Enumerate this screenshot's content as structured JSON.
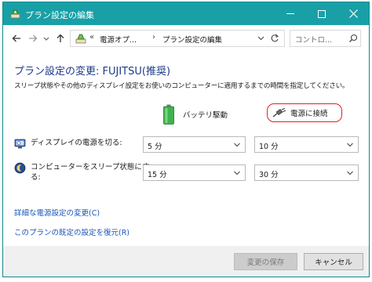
{
  "window": {
    "title": "プラン設定の編集",
    "accent": "#18a0a6"
  },
  "nav": {
    "breadcrumb_sep1": "«",
    "breadcrumb_1": "電源オプ...",
    "breadcrumb_sep2": "›",
    "breadcrumb_2": "プラン設定の編集",
    "search_placeholder": "コントロ..."
  },
  "content": {
    "heading": "プラン設定の変更: FUJITSU(推奨)",
    "description": "スリープ状態やその他のディスプレイ設定をお使いのコンピューターに適用するまでの時間を指定してください。",
    "columns": {
      "battery": "バッテリ駆動",
      "plugged_in": "電源に接続"
    },
    "rows": [
      {
        "label": "ディスプレイの電源を切る:",
        "icon": "display-off-icon",
        "battery_value": "5 分",
        "plugged_value": "10 分"
      },
      {
        "label_line1": "コンピューターをスリープ状態にす",
        "label_line2": "る:",
        "icon": "sleep-icon",
        "battery_value": "15 分",
        "plugged_value": "30 分"
      }
    ],
    "links": {
      "advanced": "詳細な電源設定の変更(C)",
      "restore": "このプランの既定の設定を復元(R)"
    }
  },
  "footer": {
    "save_label": "変更の保存",
    "cancel_label": "キャンセル"
  }
}
